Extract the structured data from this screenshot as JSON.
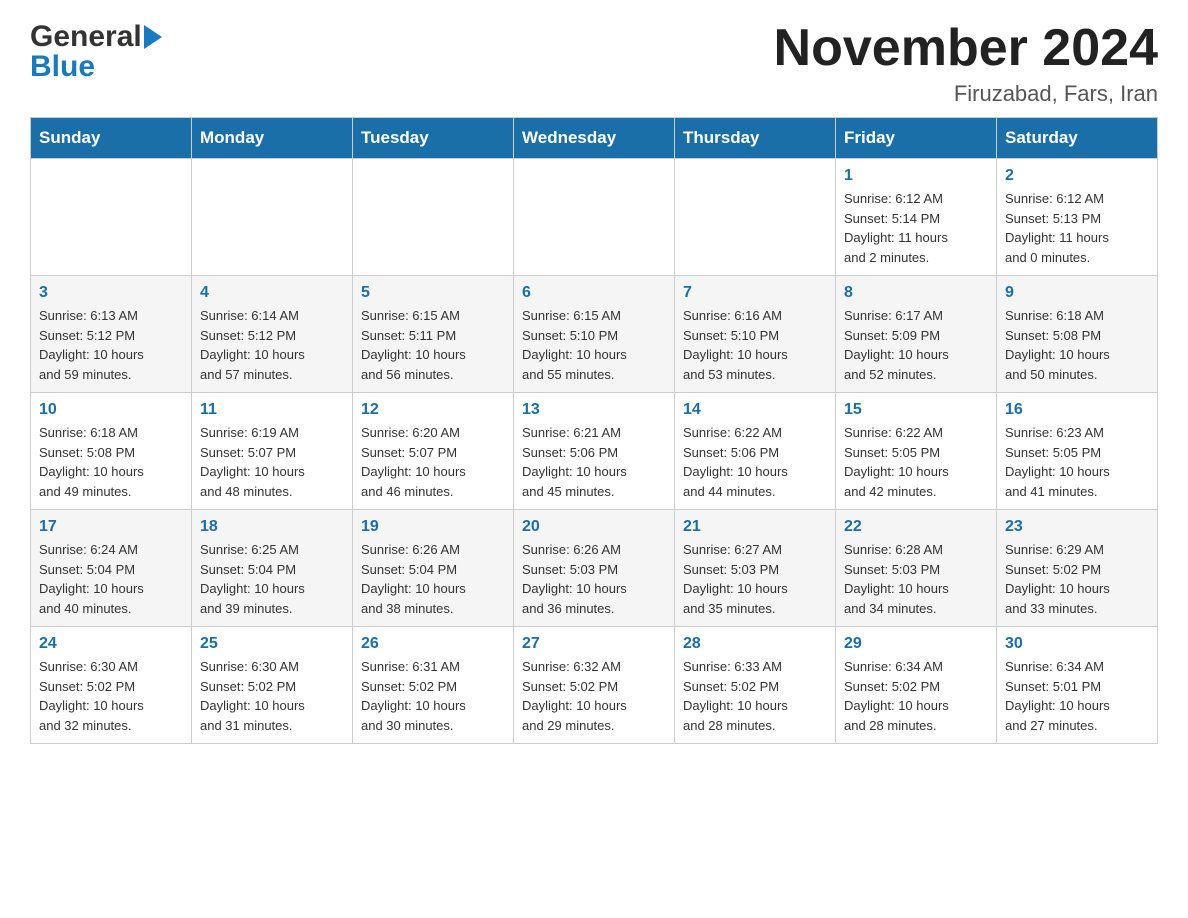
{
  "header": {
    "logo_general": "General",
    "logo_blue": "Blue",
    "month_title": "November 2024",
    "location": "Firuzabad, Fars, Iran"
  },
  "weekdays": [
    "Sunday",
    "Monday",
    "Tuesday",
    "Wednesday",
    "Thursday",
    "Friday",
    "Saturday"
  ],
  "weeks": [
    [
      {
        "day": "",
        "info": ""
      },
      {
        "day": "",
        "info": ""
      },
      {
        "day": "",
        "info": ""
      },
      {
        "day": "",
        "info": ""
      },
      {
        "day": "",
        "info": ""
      },
      {
        "day": "1",
        "info": "Sunrise: 6:12 AM\nSunset: 5:14 PM\nDaylight: 11 hours\nand 2 minutes."
      },
      {
        "day": "2",
        "info": "Sunrise: 6:12 AM\nSunset: 5:13 PM\nDaylight: 11 hours\nand 0 minutes."
      }
    ],
    [
      {
        "day": "3",
        "info": "Sunrise: 6:13 AM\nSunset: 5:12 PM\nDaylight: 10 hours\nand 59 minutes."
      },
      {
        "day": "4",
        "info": "Sunrise: 6:14 AM\nSunset: 5:12 PM\nDaylight: 10 hours\nand 57 minutes."
      },
      {
        "day": "5",
        "info": "Sunrise: 6:15 AM\nSunset: 5:11 PM\nDaylight: 10 hours\nand 56 minutes."
      },
      {
        "day": "6",
        "info": "Sunrise: 6:15 AM\nSunset: 5:10 PM\nDaylight: 10 hours\nand 55 minutes."
      },
      {
        "day": "7",
        "info": "Sunrise: 6:16 AM\nSunset: 5:10 PM\nDaylight: 10 hours\nand 53 minutes."
      },
      {
        "day": "8",
        "info": "Sunrise: 6:17 AM\nSunset: 5:09 PM\nDaylight: 10 hours\nand 52 minutes."
      },
      {
        "day": "9",
        "info": "Sunrise: 6:18 AM\nSunset: 5:08 PM\nDaylight: 10 hours\nand 50 minutes."
      }
    ],
    [
      {
        "day": "10",
        "info": "Sunrise: 6:18 AM\nSunset: 5:08 PM\nDaylight: 10 hours\nand 49 minutes."
      },
      {
        "day": "11",
        "info": "Sunrise: 6:19 AM\nSunset: 5:07 PM\nDaylight: 10 hours\nand 48 minutes."
      },
      {
        "day": "12",
        "info": "Sunrise: 6:20 AM\nSunset: 5:07 PM\nDaylight: 10 hours\nand 46 minutes."
      },
      {
        "day": "13",
        "info": "Sunrise: 6:21 AM\nSunset: 5:06 PM\nDaylight: 10 hours\nand 45 minutes."
      },
      {
        "day": "14",
        "info": "Sunrise: 6:22 AM\nSunset: 5:06 PM\nDaylight: 10 hours\nand 44 minutes."
      },
      {
        "day": "15",
        "info": "Sunrise: 6:22 AM\nSunset: 5:05 PM\nDaylight: 10 hours\nand 42 minutes."
      },
      {
        "day": "16",
        "info": "Sunrise: 6:23 AM\nSunset: 5:05 PM\nDaylight: 10 hours\nand 41 minutes."
      }
    ],
    [
      {
        "day": "17",
        "info": "Sunrise: 6:24 AM\nSunset: 5:04 PM\nDaylight: 10 hours\nand 40 minutes."
      },
      {
        "day": "18",
        "info": "Sunrise: 6:25 AM\nSunset: 5:04 PM\nDaylight: 10 hours\nand 39 minutes."
      },
      {
        "day": "19",
        "info": "Sunrise: 6:26 AM\nSunset: 5:04 PM\nDaylight: 10 hours\nand 38 minutes."
      },
      {
        "day": "20",
        "info": "Sunrise: 6:26 AM\nSunset: 5:03 PM\nDaylight: 10 hours\nand 36 minutes."
      },
      {
        "day": "21",
        "info": "Sunrise: 6:27 AM\nSunset: 5:03 PM\nDaylight: 10 hours\nand 35 minutes."
      },
      {
        "day": "22",
        "info": "Sunrise: 6:28 AM\nSunset: 5:03 PM\nDaylight: 10 hours\nand 34 minutes."
      },
      {
        "day": "23",
        "info": "Sunrise: 6:29 AM\nSunset: 5:02 PM\nDaylight: 10 hours\nand 33 minutes."
      }
    ],
    [
      {
        "day": "24",
        "info": "Sunrise: 6:30 AM\nSunset: 5:02 PM\nDaylight: 10 hours\nand 32 minutes."
      },
      {
        "day": "25",
        "info": "Sunrise: 6:30 AM\nSunset: 5:02 PM\nDaylight: 10 hours\nand 31 minutes."
      },
      {
        "day": "26",
        "info": "Sunrise: 6:31 AM\nSunset: 5:02 PM\nDaylight: 10 hours\nand 30 minutes."
      },
      {
        "day": "27",
        "info": "Sunrise: 6:32 AM\nSunset: 5:02 PM\nDaylight: 10 hours\nand 29 minutes."
      },
      {
        "day": "28",
        "info": "Sunrise: 6:33 AM\nSunset: 5:02 PM\nDaylight: 10 hours\nand 28 minutes."
      },
      {
        "day": "29",
        "info": "Sunrise: 6:34 AM\nSunset: 5:02 PM\nDaylight: 10 hours\nand 28 minutes."
      },
      {
        "day": "30",
        "info": "Sunrise: 6:34 AM\nSunset: 5:01 PM\nDaylight: 10 hours\nand 27 minutes."
      }
    ]
  ]
}
